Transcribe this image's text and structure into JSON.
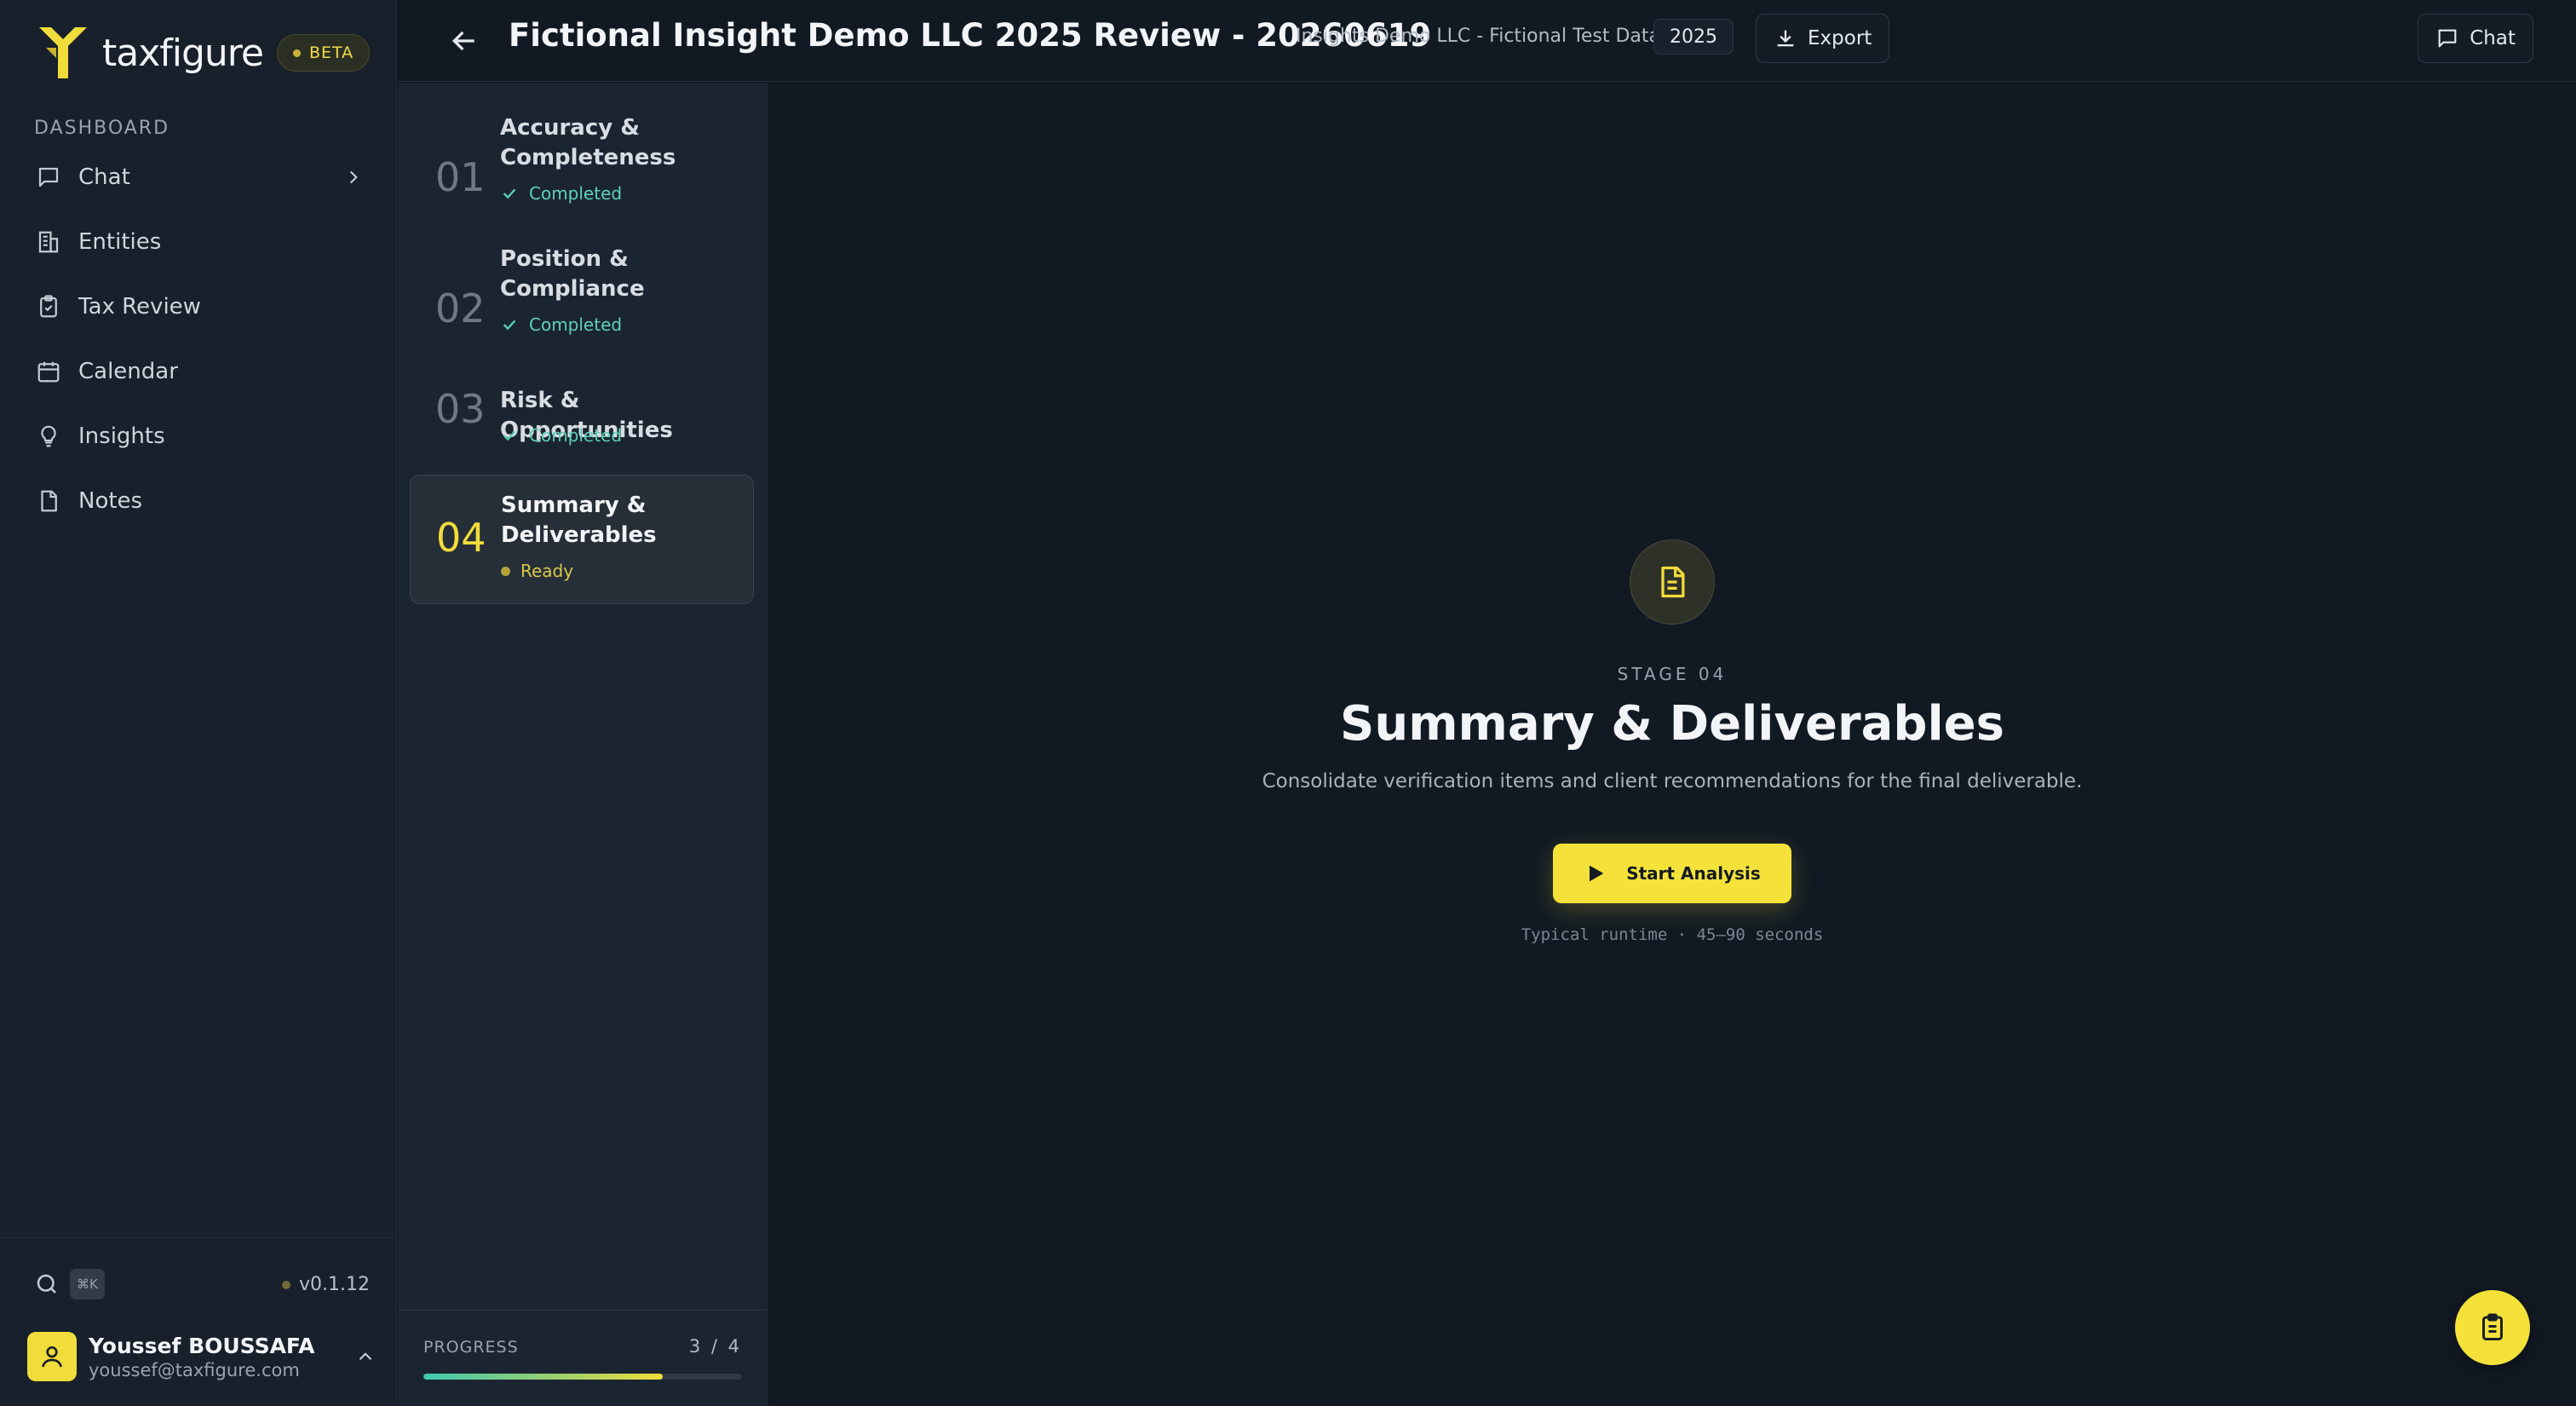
{
  "brand": {
    "name": "taxfigure",
    "badge": "BETA",
    "accent": "#f4e23a"
  },
  "sidebar": {
    "section_label": "DASHBOARD",
    "items": [
      {
        "label": "Chat",
        "icon": "chat-icon"
      },
      {
        "label": "Entities",
        "icon": "building-icon"
      },
      {
        "label": "Tax Review",
        "icon": "clipboard-check-icon"
      },
      {
        "label": "Calendar",
        "icon": "calendar-icon"
      },
      {
        "label": "Insights",
        "icon": "lightbulb-icon"
      },
      {
        "label": "Notes",
        "icon": "file-icon"
      }
    ],
    "shortcut": "⌘K",
    "version": "v0.1.12",
    "user": {
      "name": "Youssef BOUSSAFA",
      "email": "youssef@taxfigure.com"
    }
  },
  "header": {
    "title": "Fictional Insight Demo LLC 2025 Review - 20260619",
    "subtitle": "Insights Demo LLC - Fictional Test Data",
    "year": "2025",
    "export_label": "Export",
    "chat_label": "Chat"
  },
  "stages": [
    {
      "num": "01",
      "title": "Accuracy & Completeness",
      "status": "Completed"
    },
    {
      "num": "02",
      "title": "Position & Compliance",
      "status": "Completed"
    },
    {
      "num": "03",
      "title": "Risk & Opportunities",
      "status": "Completed"
    },
    {
      "num": "04",
      "title": "Summary & Deliverables",
      "status": "Ready"
    }
  ],
  "progress": {
    "label": "PROGRESS",
    "count": "3 / 4",
    "fraction": 0.75
  },
  "main": {
    "kicker": "STAGE 04",
    "heading": "Summary & Deliverables",
    "description": "Consolidate verification items and client recommendations for the final deliverable.",
    "start_label": "Start Analysis",
    "runtime": "Typical runtime · 45–90 seconds"
  }
}
